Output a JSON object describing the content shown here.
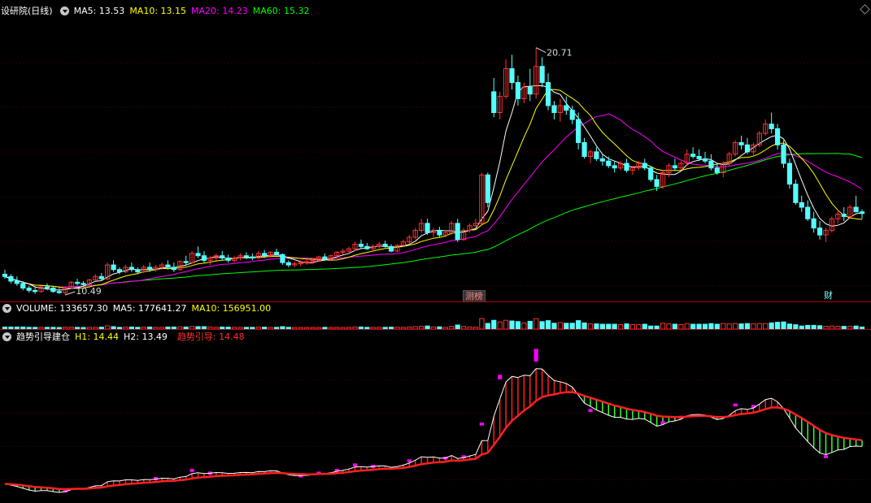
{
  "main": {
    "title": "设研院(日线)",
    "ma5": "MA5: 13.53",
    "ma10": "MA10: 13.15",
    "ma20": "MA20: 14.23",
    "ma60": "MA60: 15.32",
    "high_label": "20.71",
    "low_label": "10.49",
    "event_1": "测榜",
    "event_2": "财"
  },
  "volume": {
    "label": "VOLUME: 133657.30",
    "ma5": "MA5: 177641.27",
    "ma10": "MA10: 156951.00"
  },
  "indicator": {
    "name": "趋势引导建仓",
    "h1": "H1: 14.44",
    "h2": "H2: 13.49",
    "guide": "趋势引导: 14.48"
  },
  "colors": {
    "up": "#ff3232",
    "down": "#54ffff",
    "ma5": "#ffffff",
    "ma10": "#ffff00",
    "ma20": "#ff00ff",
    "ma60": "#00ff00",
    "guide": "#ff2020",
    "bar_up": "#ff2020",
    "bar_down": "#33ff33",
    "dot": "#ff00ff"
  },
  "chart_data": {
    "type": "candlestick",
    "price_range": [
      10.0,
      22.0
    ],
    "candles": [
      [
        10.9,
        11.1,
        10.7,
        10.8
      ],
      [
        10.8,
        10.9,
        10.5,
        10.6
      ],
      [
        10.6,
        10.8,
        10.4,
        10.5
      ],
      [
        10.5,
        10.6,
        10.2,
        10.3
      ],
      [
        10.3,
        10.4,
        10.1,
        10.2
      ],
      [
        10.2,
        10.35,
        10.05,
        10.15
      ],
      [
        10.15,
        10.4,
        10.1,
        10.35
      ],
      [
        10.35,
        10.5,
        10.2,
        10.3
      ],
      [
        10.3,
        10.4,
        10.1,
        10.15
      ],
      [
        10.15,
        10.3,
        10.05,
        10.1
      ],
      [
        10.1,
        10.35,
        10.0,
        10.3
      ],
      [
        10.3,
        10.6,
        10.25,
        10.55
      ],
      [
        10.55,
        10.7,
        10.4,
        10.5
      ],
      [
        10.5,
        10.6,
        10.35,
        10.45
      ],
      [
        10.45,
        10.7,
        10.4,
        10.65
      ],
      [
        10.65,
        10.9,
        10.6,
        10.8
      ],
      [
        10.8,
        10.95,
        10.6,
        10.7
      ],
      [
        10.7,
        11.4,
        10.65,
        11.3
      ],
      [
        11.3,
        11.5,
        11.0,
        11.1
      ],
      [
        11.1,
        11.2,
        10.9,
        11.0
      ],
      [
        11.0,
        11.3,
        10.95,
        11.2
      ],
      [
        11.2,
        11.4,
        11.0,
        11.1
      ],
      [
        11.1,
        11.2,
        10.9,
        11.0
      ],
      [
        11.0,
        11.3,
        10.95,
        11.2
      ],
      [
        11.2,
        11.4,
        11.0,
        11.1
      ],
      [
        11.1,
        11.3,
        11.0,
        11.2
      ],
      [
        11.2,
        11.4,
        11.1,
        11.3
      ],
      [
        11.3,
        11.5,
        11.1,
        11.2
      ],
      [
        11.2,
        11.4,
        11.0,
        11.1
      ],
      [
        11.1,
        11.5,
        11.05,
        11.45
      ],
      [
        11.45,
        11.7,
        11.3,
        11.4
      ],
      [
        11.4,
        11.9,
        11.35,
        11.8
      ],
      [
        11.8,
        12.1,
        11.6,
        11.7
      ],
      [
        11.7,
        11.9,
        11.4,
        11.5
      ],
      [
        11.5,
        11.7,
        11.3,
        11.6
      ],
      [
        11.6,
        11.8,
        11.5,
        11.7
      ],
      [
        11.7,
        11.9,
        11.5,
        11.6
      ],
      [
        11.6,
        11.75,
        11.4,
        11.5
      ],
      [
        11.5,
        11.7,
        11.4,
        11.6
      ],
      [
        11.6,
        11.8,
        11.5,
        11.7
      ],
      [
        11.7,
        11.85,
        11.55,
        11.65
      ],
      [
        11.65,
        11.8,
        11.5,
        11.6
      ],
      [
        11.6,
        11.9,
        11.55,
        11.8
      ],
      [
        11.8,
        11.95,
        11.6,
        11.7
      ],
      [
        11.7,
        11.9,
        11.6,
        11.85
      ],
      [
        11.85,
        12.0,
        11.7,
        11.75
      ],
      [
        11.75,
        11.8,
        11.3,
        11.4
      ],
      [
        11.4,
        11.5,
        11.2,
        11.3
      ],
      [
        11.3,
        11.45,
        11.2,
        11.35
      ],
      [
        11.35,
        11.5,
        11.25,
        11.4
      ],
      [
        11.4,
        11.55,
        11.3,
        11.45
      ],
      [
        11.45,
        11.6,
        11.35,
        11.5
      ],
      [
        11.5,
        11.7,
        11.45,
        11.65
      ],
      [
        11.65,
        11.8,
        11.5,
        11.55
      ],
      [
        11.55,
        11.75,
        11.5,
        11.7
      ],
      [
        11.7,
        11.9,
        11.6,
        11.85
      ],
      [
        11.85,
        12.0,
        11.75,
        11.9
      ],
      [
        11.9,
        12.1,
        11.8,
        12.0
      ],
      [
        12.0,
        12.3,
        11.9,
        12.2
      ],
      [
        12.2,
        12.4,
        12.0,
        12.1
      ],
      [
        12.1,
        12.25,
        11.95,
        12.0
      ],
      [
        12.0,
        12.2,
        11.9,
        12.1
      ],
      [
        12.1,
        12.3,
        12.0,
        12.2
      ],
      [
        12.2,
        12.35,
        12.05,
        12.1
      ],
      [
        12.1,
        12.2,
        11.85,
        11.9
      ],
      [
        11.9,
        12.2,
        11.85,
        12.15
      ],
      [
        12.15,
        12.4,
        12.1,
        12.3
      ],
      [
        12.3,
        12.6,
        12.2,
        12.5
      ],
      [
        12.5,
        12.9,
        12.4,
        12.8
      ],
      [
        12.8,
        13.3,
        12.7,
        13.1
      ],
      [
        13.1,
        13.3,
        12.6,
        12.7
      ],
      [
        12.7,
        12.9,
        12.5,
        12.8
      ],
      [
        12.8,
        12.95,
        12.5,
        12.6
      ],
      [
        12.6,
        12.8,
        12.5,
        12.7
      ],
      [
        12.7,
        13.2,
        12.6,
        13.1
      ],
      [
        13.1,
        13.3,
        12.3,
        12.4
      ],
      [
        12.4,
        12.9,
        12.35,
        12.8
      ],
      [
        12.8,
        13.1,
        12.7,
        13.0
      ],
      [
        13.0,
        13.3,
        12.95,
        13.1
      ],
      [
        13.1,
        15.3,
        13.05,
        15.2
      ],
      [
        15.2,
        15.3,
        13.8,
        14.0
      ],
      [
        18.8,
        19.4,
        17.7,
        17.9
      ],
      [
        17.9,
        18.8,
        17.6,
        18.6
      ],
      [
        18.6,
        20.2,
        18.5,
        19.8
      ],
      [
        19.8,
        20.4,
        18.9,
        19.2
      ],
      [
        19.2,
        19.5,
        18.2,
        18.5
      ],
      [
        18.5,
        19.2,
        18.3,
        19.0
      ],
      [
        19.0,
        19.8,
        18.4,
        18.7
      ],
      [
        18.7,
        20.71,
        18.5,
        19.9
      ],
      [
        19.9,
        20.3,
        19.0,
        19.2
      ],
      [
        19.2,
        19.6,
        18.0,
        18.2
      ],
      [
        18.2,
        18.4,
        17.6,
        17.9
      ],
      [
        17.9,
        18.5,
        17.5,
        18.2
      ],
      [
        18.2,
        18.6,
        17.8,
        18.0
      ],
      [
        18.0,
        18.2,
        17.4,
        17.6
      ],
      [
        17.6,
        17.9,
        16.3,
        16.6
      ],
      [
        16.6,
        16.8,
        15.9,
        16.0
      ],
      [
        16.0,
        16.3,
        15.7,
        16.2
      ],
      [
        16.2,
        16.4,
        15.8,
        15.9
      ],
      [
        15.9,
        16.1,
        15.6,
        15.8
      ],
      [
        15.8,
        16.0,
        15.5,
        15.6
      ],
      [
        15.6,
        15.8,
        15.3,
        15.5
      ],
      [
        15.5,
        15.8,
        15.4,
        15.7
      ],
      [
        15.7,
        15.9,
        15.3,
        15.4
      ],
      [
        15.4,
        15.6,
        15.2,
        15.5
      ],
      [
        15.5,
        15.8,
        15.4,
        15.7
      ],
      [
        15.7,
        15.9,
        15.4,
        15.5
      ],
      [
        15.5,
        15.6,
        14.9,
        15.0
      ],
      [
        15.0,
        15.2,
        14.5,
        14.7
      ],
      [
        14.7,
        15.4,
        14.6,
        15.3
      ],
      [
        15.3,
        15.7,
        15.1,
        15.6
      ],
      [
        15.6,
        15.9,
        15.4,
        15.5
      ],
      [
        15.5,
        15.8,
        15.4,
        15.7
      ],
      [
        15.7,
        16.3,
        15.6,
        16.1
      ],
      [
        16.1,
        16.4,
        15.9,
        16.0
      ],
      [
        16.0,
        16.3,
        15.8,
        15.9
      ],
      [
        15.9,
        16.2,
        15.7,
        15.8
      ],
      [
        15.8,
        16.1,
        15.4,
        15.5
      ],
      [
        15.5,
        15.7,
        15.2,
        15.3
      ],
      [
        15.3,
        15.8,
        15.1,
        15.7
      ],
      [
        15.7,
        16.2,
        15.6,
        16.1
      ],
      [
        16.1,
        16.7,
        16.0,
        16.6
      ],
      [
        16.6,
        16.9,
        16.3,
        16.5
      ],
      [
        16.5,
        16.8,
        16.1,
        16.2
      ],
      [
        16.2,
        16.6,
        16.0,
        16.5
      ],
      [
        16.5,
        17.1,
        16.4,
        17.0
      ],
      [
        17.0,
        17.6,
        16.9,
        17.4
      ],
      [
        17.4,
        17.9,
        17.0,
        17.2
      ],
      [
        17.2,
        17.4,
        16.3,
        16.5
      ],
      [
        16.5,
        16.7,
        15.5,
        15.7
      ],
      [
        15.7,
        15.9,
        14.6,
        14.8
      ],
      [
        14.8,
        15.0,
        13.9,
        14.0
      ],
      [
        14.0,
        14.3,
        13.6,
        13.8
      ],
      [
        13.8,
        14.1,
        13.2,
        13.3
      ],
      [
        13.3,
        13.6,
        12.7,
        12.9
      ],
      [
        12.9,
        13.2,
        12.4,
        12.6
      ],
      [
        12.6,
        12.9,
        12.3,
        12.8
      ],
      [
        12.8,
        13.4,
        12.7,
        13.3
      ],
      [
        13.3,
        13.7,
        13.1,
        13.5
      ],
      [
        13.5,
        13.8,
        13.2,
        13.4
      ],
      [
        13.4,
        13.9,
        13.3,
        13.8
      ],
      [
        13.8,
        14.3,
        13.6,
        13.6
      ],
      [
        13.6,
        13.7,
        13.3,
        13.53
      ]
    ]
  }
}
